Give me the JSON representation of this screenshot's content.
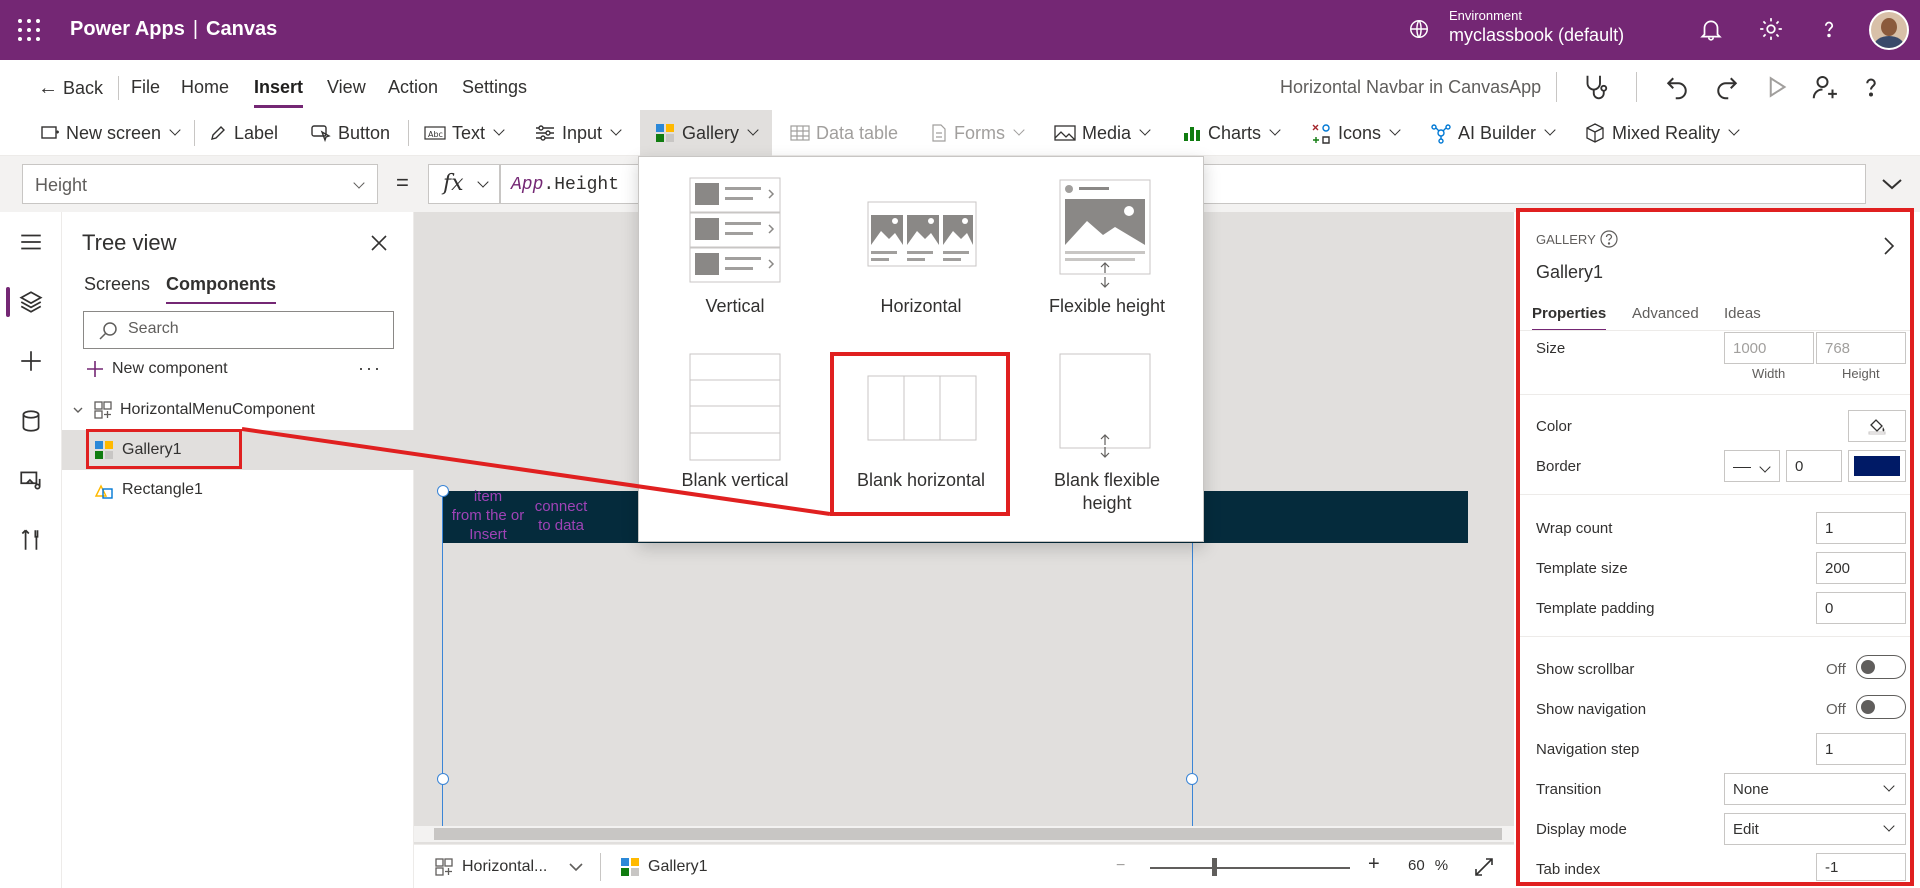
{
  "app": {
    "product": "Power Apps",
    "separator": "|",
    "kind": "Canvas"
  },
  "environment": {
    "label": "Environment",
    "value": "myclassbook (default)"
  },
  "menu": {
    "back": "Back",
    "items": [
      "File",
      "Home",
      "Insert",
      "View",
      "Action",
      "Settings"
    ],
    "active": "Insert",
    "app_name": "Horizontal Navbar in CanvasApp"
  },
  "ribbon": {
    "new_screen": "New screen",
    "label": "Label",
    "button": "Button",
    "text": "Text",
    "input": "Input",
    "gallery": "Gallery",
    "data_table": "Data table",
    "forms": "Forms",
    "media": "Media",
    "charts": "Charts",
    "icons": "Icons",
    "ai_builder": "AI Builder",
    "mixed_reality": "Mixed Reality"
  },
  "formula_bar": {
    "property": "Height",
    "equals": "=",
    "fx": "fx",
    "formula_obj": "App",
    "formula_rest": ".Height"
  },
  "tree": {
    "title": "Tree view",
    "tabs": [
      "Screens",
      "Components"
    ],
    "search_placeholder": "Search",
    "new_component": "New component",
    "more": "···",
    "nodes": [
      {
        "label": "HorizontalMenuComponent"
      },
      {
        "label": "Gallery1"
      },
      {
        "label": "Rectangle1"
      }
    ]
  },
  "canvas": {
    "hint1": "item\nfrom the or\nInsert",
    "hint2": "connect\nto data"
  },
  "gallery_menu": {
    "options": [
      "Vertical",
      "Horizontal",
      "Flexible height",
      "Blank vertical",
      "Blank horizontal",
      "Blank flexible height"
    ]
  },
  "status": {
    "screen": "Horizontal...",
    "selected": "Gallery1",
    "zoom": "60",
    "zoom_unit": "%",
    "minus": "−",
    "plus": "+"
  },
  "panel": {
    "type": "GALLERY",
    "name": "Gallery1",
    "tabs": [
      "Properties",
      "Advanced",
      "Ideas"
    ],
    "size_label": "Size",
    "width": "1000",
    "height": "768",
    "width_label": "Width",
    "height_label": "Height",
    "color_label": "Color",
    "border_label": "Border",
    "border_value": "0",
    "border_color": "#001a66",
    "wrap_count_label": "Wrap count",
    "wrap_count": "1",
    "template_size_label": "Template size",
    "template_size": "200",
    "template_padding_label": "Template padding",
    "template_padding": "0",
    "show_scrollbar_label": "Show scrollbar",
    "show_scrollbar": "Off",
    "show_navigation_label": "Show navigation",
    "show_navigation": "Off",
    "navigation_step_label": "Navigation step",
    "navigation_step": "1",
    "transition_label": "Transition",
    "transition": "None",
    "display_mode_label": "Display mode",
    "display_mode": "Edit",
    "tab_index_label": "Tab index",
    "tab_index": "-1"
  },
  "colors": {
    "brand": "#742774",
    "highlight": "#e02020",
    "component_bar": "#052b3c"
  }
}
